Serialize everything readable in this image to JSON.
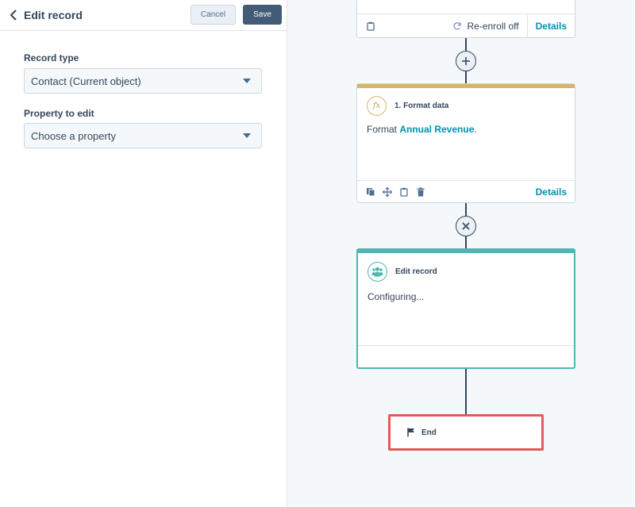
{
  "panel": {
    "title": "Edit record",
    "cancel_label": "Cancel",
    "save_label": "Save",
    "record_type": {
      "label": "Record type",
      "value": "Contact (Current object)"
    },
    "property_to_edit": {
      "label": "Property to edit",
      "value": "Choose a property"
    }
  },
  "workflow": {
    "top_card": {
      "reenroll_label": "Re-enroll off",
      "details_label": "Details"
    },
    "format_card": {
      "title": "1. Format data",
      "body_prefix": "Format ",
      "body_property": "Annual Revenue",
      "body_suffix": ".",
      "details_label": "Details",
      "accent_color": "#d9b36c"
    },
    "edit_card": {
      "title": "Edit record",
      "body": "Configuring...",
      "accent_color": "#4fb6b0"
    },
    "end": {
      "label": "End",
      "border_color": "#e05b5b"
    }
  },
  "icons": {
    "back": "chevron-left-icon",
    "add": "plus-icon",
    "remove": "close-icon",
    "clipboard": "clipboard-icon",
    "reenroll": "refresh-icon",
    "copy": "copy-icon",
    "move": "move-icon",
    "trash": "trash-icon",
    "formula": "fx-icon",
    "contacts": "contacts-icon",
    "flag": "flag-icon"
  }
}
